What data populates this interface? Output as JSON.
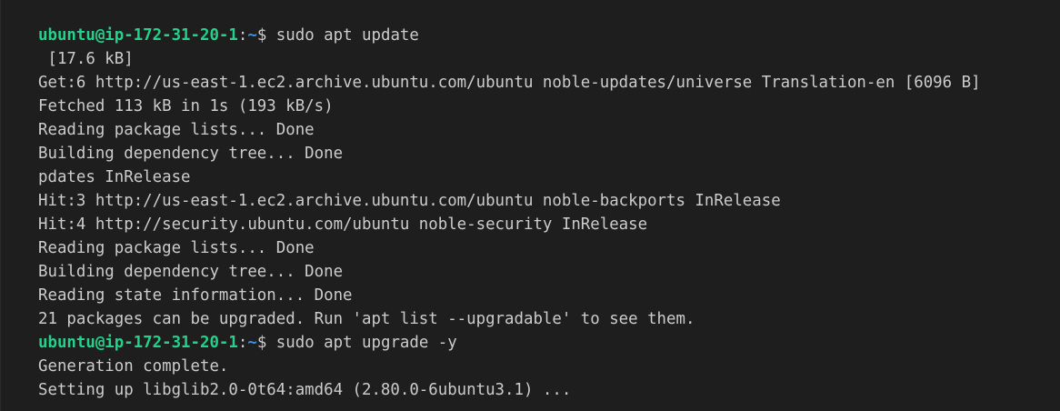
{
  "terminal": {
    "background": "#1e1e1e",
    "text_color": "#cccccc",
    "user_color": "#23d18b",
    "path_color": "#3b8eea",
    "lines": [
      {
        "type": "prompt",
        "user": "ubuntu@ip-172-31-20-1",
        "sep": ":",
        "path": "~",
        "dollar": "$",
        "command": " sudo apt update"
      },
      {
        "type": "text",
        "text": " [17.6 kB]"
      },
      {
        "type": "text",
        "text": "Get:6 http://us-east-1.ec2.archive.ubuntu.com/ubuntu noble-updates/universe Translation-en [6096 B]"
      },
      {
        "type": "text",
        "text": "Fetched 113 kB in 1s (193 kB/s)"
      },
      {
        "type": "text",
        "text": "Reading package lists... Done"
      },
      {
        "type": "text",
        "text": "Building dependency tree... Done"
      },
      {
        "type": "text",
        "text": "pdates InRelease"
      },
      {
        "type": "text",
        "text": "Hit:3 http://us-east-1.ec2.archive.ubuntu.com/ubuntu noble-backports InRelease"
      },
      {
        "type": "text",
        "text": "Hit:4 http://security.ubuntu.com/ubuntu noble-security InRelease"
      },
      {
        "type": "text",
        "text": "Reading package lists... Done"
      },
      {
        "type": "text",
        "text": "Building dependency tree... Done"
      },
      {
        "type": "text",
        "text": "Reading state information... Done"
      },
      {
        "type": "text",
        "text": "21 packages can be upgraded. Run 'apt list --upgradable' to see them."
      },
      {
        "type": "prompt",
        "user": "ubuntu@ip-172-31-20-1",
        "sep": ":",
        "path": "~",
        "dollar": "$",
        "command": " sudo apt upgrade -y"
      },
      {
        "type": "text",
        "text": "Generation complete."
      },
      {
        "type": "text",
        "text": "Setting up libglib2.0-0t64:amd64 (2.80.0-6ubuntu3.1) ..."
      }
    ]
  }
}
